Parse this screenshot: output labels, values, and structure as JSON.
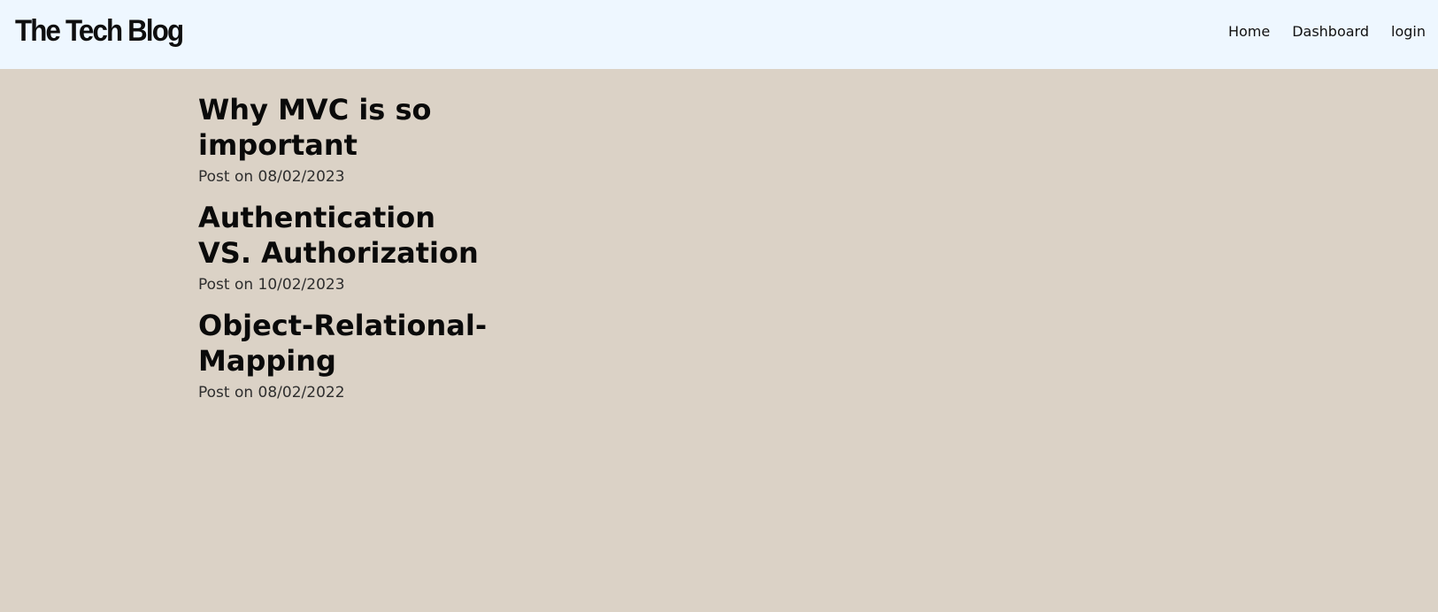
{
  "nav": {
    "brand": "The Tech Blog",
    "links": [
      "Home",
      "Dashboard",
      "login"
    ]
  },
  "posts": [
    {
      "title": "Why MVC is so important",
      "date": "Post on 08/02/2023"
    },
    {
      "title": "Authentication VS. Authorization",
      "date": "Post on 10/02/2023"
    },
    {
      "title": "Object-Relational-Mapping",
      "date": "Post on 08/02/2022"
    }
  ]
}
